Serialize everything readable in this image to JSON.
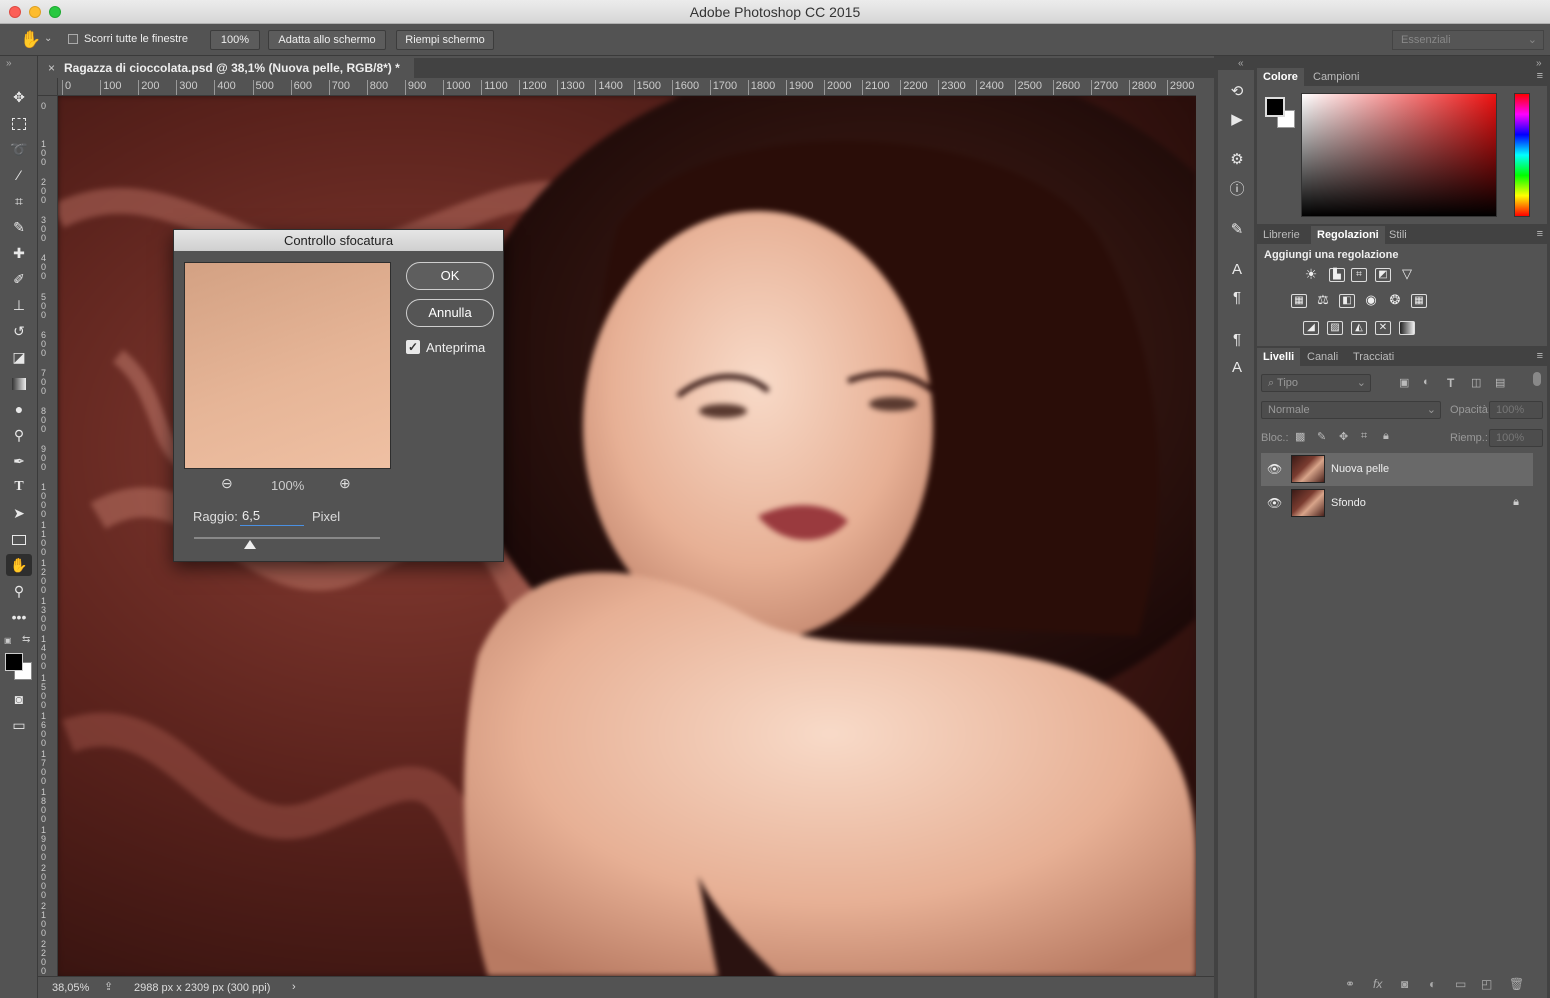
{
  "app_title": "Adobe Photoshop CC 2015",
  "options": {
    "scroll_all": "Scorri tutte le finestre",
    "zoom_btn": "100%",
    "fit_btn": "Adatta allo schermo",
    "fill_btn": "Riempi schermo",
    "workspace": "Essenziali"
  },
  "document": {
    "tab_title": "Ragazza di cioccolata.psd @ 38,1% (Nuova pelle, RGB/8*) *",
    "close": "×"
  },
  "ruler": {
    "h_labels": [
      "0",
      "100",
      "200",
      "300",
      "400",
      "500",
      "600",
      "700",
      "800",
      "900",
      "1000",
      "1100",
      "1200",
      "1300",
      "1400",
      "1500",
      "1600",
      "1700",
      "1800",
      "1900",
      "2000",
      "2100",
      "2200",
      "2300",
      "2400",
      "2500",
      "2600",
      "2700",
      "2800",
      "2900"
    ],
    "v_labels": [
      "0",
      "1 0 0",
      "2 0 0",
      "3 0 0",
      "4 0 0",
      "5 0 0",
      "6 0 0",
      "7 0 0",
      "8 0 0",
      "9 0 0",
      "1 0 0 0",
      "1 1 0 0",
      "1 2 0 0",
      "1 3 0 0",
      "1 4 0 0",
      "1 5 0 0",
      "1 6 0 0",
      "1 7 0 0",
      "1 8 0 0",
      "1 9 0 0",
      "2 0 0 0",
      "2 1 0 0",
      "2 2 0 0",
      "2 3 0 0"
    ]
  },
  "status": {
    "zoom": "38,05%",
    "doc_size": "2988 px x 2309 px (300 ppi)",
    "arrow": "›"
  },
  "dialog": {
    "title": "Controllo sfocatura",
    "ok": "OK",
    "cancel": "Annulla",
    "preview_label": "Anteprima",
    "preview_checked": true,
    "zoom": "100%",
    "radius_label": "Raggio:",
    "radius_value": "6,5",
    "unit": "Pixel",
    "slider_fraction": 0.3
  },
  "color_panel": {
    "tabs": [
      "Colore",
      "Campioni"
    ],
    "foreground": "#000000",
    "background": "#ffffff"
  },
  "adjust_panel": {
    "tabs": [
      "Librerie",
      "Regolazioni",
      "Stili"
    ],
    "heading": "Aggiungi una regolazione"
  },
  "layers_panel": {
    "tabs": [
      "Livelli",
      "Canali",
      "Tracciati"
    ],
    "filter": "Tipo",
    "blend": "Normale",
    "opacity_label": "Opacità:",
    "opacity_value": "100%",
    "lock_label": "Bloc.:",
    "fill_label": "Riemp.:",
    "fill_value": "100%",
    "layers": [
      {
        "name": "Nuova pelle",
        "selected": true,
        "locked": false
      },
      {
        "name": "Sfondo",
        "selected": false,
        "locked": true
      }
    ]
  }
}
